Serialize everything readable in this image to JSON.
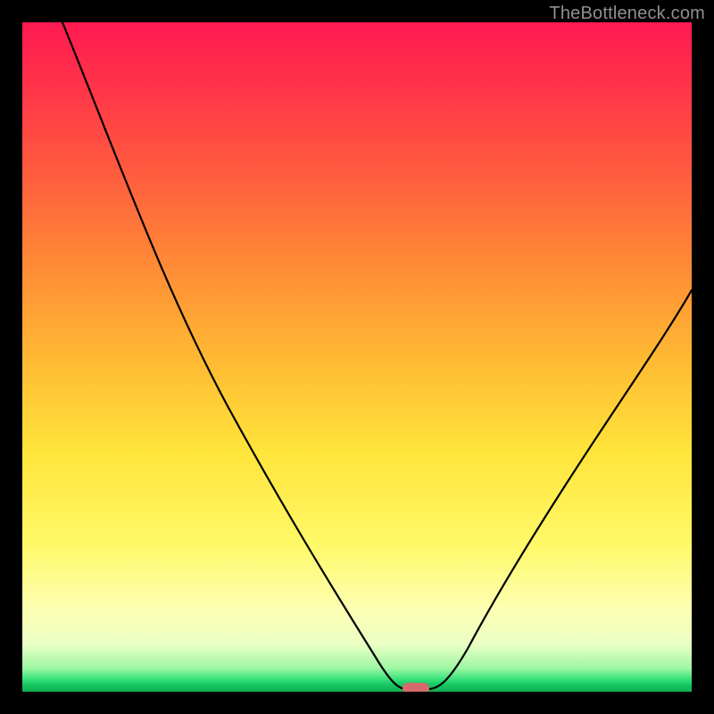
{
  "watermark": {
    "text": "TheBottleneck.com"
  },
  "marker": {
    "x_frac": 0.575,
    "color": "#d46a6a"
  },
  "chart_data": {
    "type": "line",
    "title": "",
    "xlabel": "",
    "ylabel": "",
    "xlim": [
      0,
      1
    ],
    "ylim": [
      0,
      100
    ],
    "series": [
      {
        "name": "bottleneck-curve",
        "x": [
          0.0,
          0.05,
          0.1,
          0.15,
          0.2,
          0.25,
          0.3,
          0.35,
          0.4,
          0.45,
          0.5,
          0.53,
          0.56,
          0.59,
          0.62,
          0.66,
          0.72,
          0.78,
          0.85,
          0.92,
          1.0
        ],
        "values": [
          100,
          92,
          83,
          74,
          66,
          58,
          50,
          42,
          33,
          24,
          14,
          7,
          2,
          0,
          2,
          7,
          16,
          26,
          37,
          48,
          60
        ]
      }
    ],
    "background_gradient_stops": [
      {
        "pos": 0.0,
        "color": "#ff1a52"
      },
      {
        "pos": 0.5,
        "color": "#ffb833"
      },
      {
        "pos": 0.88,
        "color": "#fdffb5"
      },
      {
        "pos": 0.97,
        "color": "#9cf7a3"
      },
      {
        "pos": 1.0,
        "color": "#0fae53"
      }
    ],
    "marker": {
      "x": 0.575,
      "y": 0,
      "shape": "rounded-rect",
      "color": "#d46a6a"
    }
  }
}
